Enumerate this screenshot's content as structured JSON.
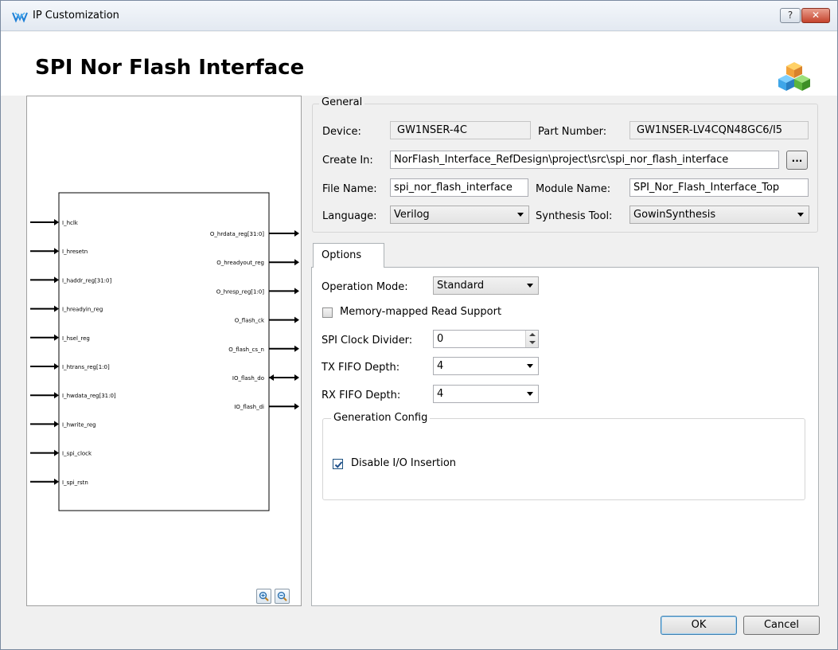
{
  "window": {
    "title": "IP Customization",
    "help_label": "?",
    "close_label": "✕"
  },
  "header": {
    "title": "SPI Nor Flash Interface"
  },
  "diagram": {
    "inputs": [
      "I_hclk",
      "I_hresetn",
      "I_haddr_reg[31:0]",
      "I_hreadyin_reg",
      "I_hsel_reg",
      "I_htrans_reg[1:0]",
      "I_hwdata_reg[31:0]",
      "I_hwrite_reg",
      "I_spi_clock",
      "I_spi_rstn"
    ],
    "outputs": [
      "O_hrdata_reg[31:0]",
      "O_hreadyout_reg",
      "O_hresp_reg[1:0]",
      "O_flash_ck",
      "O_flash_cs_n",
      "IO_flash_do",
      "IO_flash_di"
    ]
  },
  "general": {
    "group_label": "General",
    "device_label": "Device:",
    "device_value": "GW1NSER-4C",
    "part_number_label": "Part Number:",
    "part_number_value": "GW1NSER-LV4CQN48GC6/I5",
    "create_in_label": "Create In:",
    "create_in_value": "NorFlash_Interface_RefDesign\\project\\src\\spi_nor_flash_interface",
    "browse_label": "...",
    "file_name_label": "File Name:",
    "file_name_value": "spi_nor_flash_interface",
    "module_name_label": "Module Name:",
    "module_name_value": "SPI_Nor_Flash_Interface_Top",
    "language_label": "Language:",
    "language_value": "Verilog",
    "synthesis_tool_label": "Synthesis Tool:",
    "synthesis_tool_value": "GowinSynthesis"
  },
  "options": {
    "tab_label": "Options",
    "operation_mode_label": "Operation Mode:",
    "operation_mode_value": "Standard",
    "memory_mapped_label": "Memory-mapped Read Support",
    "memory_mapped_checked": false,
    "spi_clock_divider_label": "SPI Clock Divider:",
    "spi_clock_divider_value": "0",
    "tx_fifo_label": "TX FIFO Depth:",
    "tx_fifo_value": "4",
    "rx_fifo_label": "RX FIFO Depth:",
    "rx_fifo_value": "4",
    "generation_config_label": "Generation Config",
    "disable_io_label": "Disable I/O Insertion",
    "disable_io_checked": true
  },
  "buttons": {
    "ok_label": "OK",
    "cancel_label": "Cancel"
  },
  "colors": {
    "accent": "#3c7fb1",
    "close": "#c5432c"
  }
}
